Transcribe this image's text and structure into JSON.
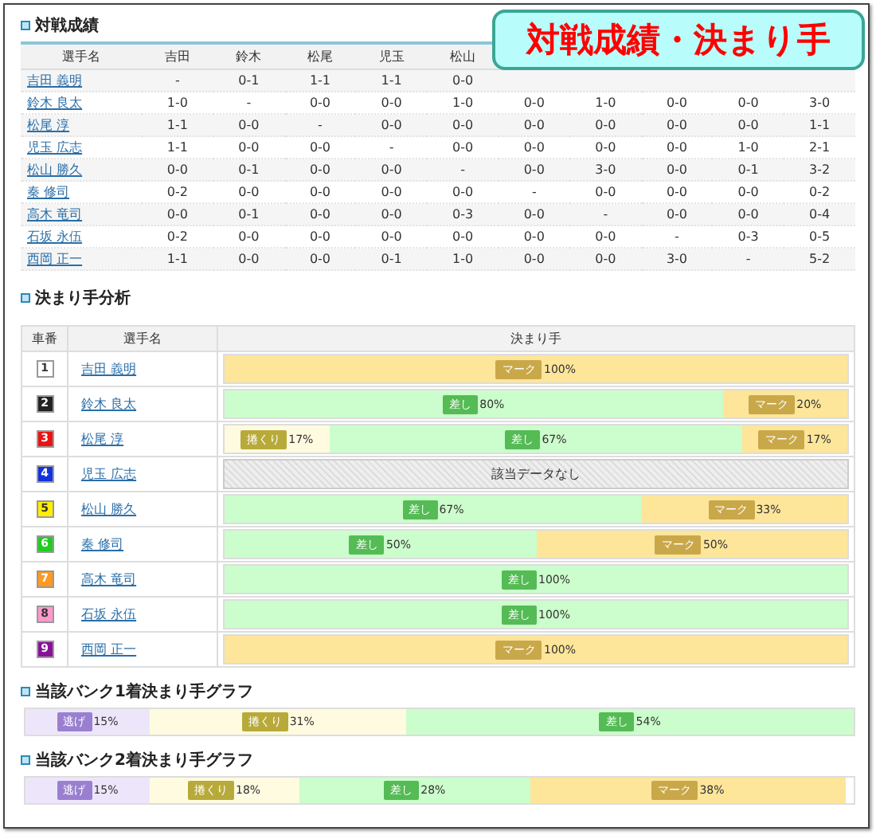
{
  "banner": {
    "title": "対戦成績・決まり手"
  },
  "matchups": {
    "title": "対戦成績",
    "columns": [
      "選手名",
      "吉田",
      "鈴木",
      "松尾",
      "児玉",
      "松山"
    ],
    "rows": [
      {
        "cells": [
          "吉田 義明",
          "-",
          "0-1",
          "1-1",
          "1-1",
          "0-0"
        ]
      },
      {
        "cells": [
          "鈴木 良太",
          "1-0",
          "-",
          "0-0",
          "0-0",
          "1-0",
          "0-0",
          "1-0",
          "0-0",
          "0-0",
          "3-0"
        ]
      },
      {
        "cells": [
          "松尾 淳",
          "1-1",
          "0-0",
          "-",
          "0-0",
          "0-0",
          "0-0",
          "0-0",
          "0-0",
          "0-0",
          "1-1"
        ]
      },
      {
        "cells": [
          "児玉 広志",
          "1-1",
          "0-0",
          "0-0",
          "-",
          "0-0",
          "0-0",
          "0-0",
          "0-0",
          "1-0",
          "2-1"
        ]
      },
      {
        "cells": [
          "松山 勝久",
          "0-0",
          "0-1",
          "0-0",
          "0-0",
          "-",
          "0-0",
          "3-0",
          "0-0",
          "0-1",
          "3-2"
        ]
      },
      {
        "cells": [
          "秦 修司",
          "0-2",
          "0-0",
          "0-0",
          "0-0",
          "0-0",
          "-",
          "0-0",
          "0-0",
          "0-0",
          "0-2"
        ]
      },
      {
        "cells": [
          "高木 竜司",
          "0-0",
          "0-1",
          "0-0",
          "0-0",
          "0-3",
          "0-0",
          "-",
          "0-0",
          "0-0",
          "0-4"
        ]
      },
      {
        "cells": [
          "石坂 永伍",
          "0-2",
          "0-0",
          "0-0",
          "0-0",
          "0-0",
          "0-0",
          "0-0",
          "-",
          "0-3",
          "0-5"
        ]
      },
      {
        "cells": [
          "西岡 正一",
          "1-1",
          "0-0",
          "0-0",
          "0-1",
          "1-0",
          "0-0",
          "0-0",
          "3-0",
          "-",
          "5-2"
        ]
      }
    ]
  },
  "analysis": {
    "title": "決まり手分析",
    "columns": [
      "車番",
      "選手名",
      "決まり手"
    ],
    "rows": [
      {
        "number": "1",
        "color": "#ffffff",
        "name": "吉田 義明",
        "segments": [
          {
            "kind": "mark",
            "label": "マーク",
            "value": "100%"
          }
        ]
      },
      {
        "number": "2",
        "color": "#222222",
        "name": "鈴木 良太",
        "segments": [
          {
            "kind": "sashi",
            "label": "差し",
            "value": "80%"
          },
          {
            "kind": "mark",
            "label": "マーク",
            "value": "20%"
          }
        ]
      },
      {
        "number": "3",
        "color": "#ee1111",
        "name": "松尾 淳",
        "segments": [
          {
            "kind": "makuri",
            "label": "捲くり",
            "value": "17%"
          },
          {
            "kind": "sashi",
            "label": "差し",
            "value": "67%"
          },
          {
            "kind": "mark",
            "label": "マーク",
            "value": "17%"
          }
        ]
      },
      {
        "number": "4",
        "color": "#1133dd",
        "name": "児玉 広志",
        "empty": "該当データなし"
      },
      {
        "number": "5",
        "color": "#ffee00",
        "name": "松山 勝久",
        "segments": [
          {
            "kind": "sashi",
            "label": "差し",
            "value": "67%"
          },
          {
            "kind": "mark",
            "label": "マーク",
            "value": "33%"
          }
        ]
      },
      {
        "number": "6",
        "color": "#22cc22",
        "name": "秦 修司",
        "segments": [
          {
            "kind": "sashi",
            "label": "差し",
            "value": "50%"
          },
          {
            "kind": "mark",
            "label": "マーク",
            "value": "50%"
          }
        ]
      },
      {
        "number": "7",
        "color": "#ff9922",
        "name": "高木 竜司",
        "segments": [
          {
            "kind": "sashi",
            "label": "差し",
            "value": "100%"
          }
        ]
      },
      {
        "number": "8",
        "color": "#ff99cc",
        "name": "石坂 永伍",
        "segments": [
          {
            "kind": "sashi",
            "label": "差し",
            "value": "100%"
          }
        ]
      },
      {
        "number": "9",
        "color": "#881199",
        "name": "西岡 正一",
        "segments": [
          {
            "kind": "mark",
            "label": "マーク",
            "value": "100%"
          }
        ]
      }
    ]
  },
  "bank_graphs": [
    {
      "title": "当該バンク1着決まり手グラフ",
      "segments": [
        {
          "kind": "nige",
          "label": "逃げ",
          "value": "15%"
        },
        {
          "kind": "makuri",
          "label": "捲くり",
          "value": "31%"
        },
        {
          "kind": "sashi",
          "label": "差し",
          "value": "54%"
        }
      ]
    },
    {
      "title": "当該バンク2着決まり手グラフ",
      "segments": [
        {
          "kind": "nige",
          "label": "逃げ",
          "value": "15%"
        },
        {
          "kind": "makuri",
          "label": "捲くり",
          "value": "18%"
        },
        {
          "kind": "sashi",
          "label": "差し",
          "value": "28%"
        },
        {
          "kind": "mark",
          "label": "マーク",
          "value": "38%"
        }
      ]
    }
  ]
}
